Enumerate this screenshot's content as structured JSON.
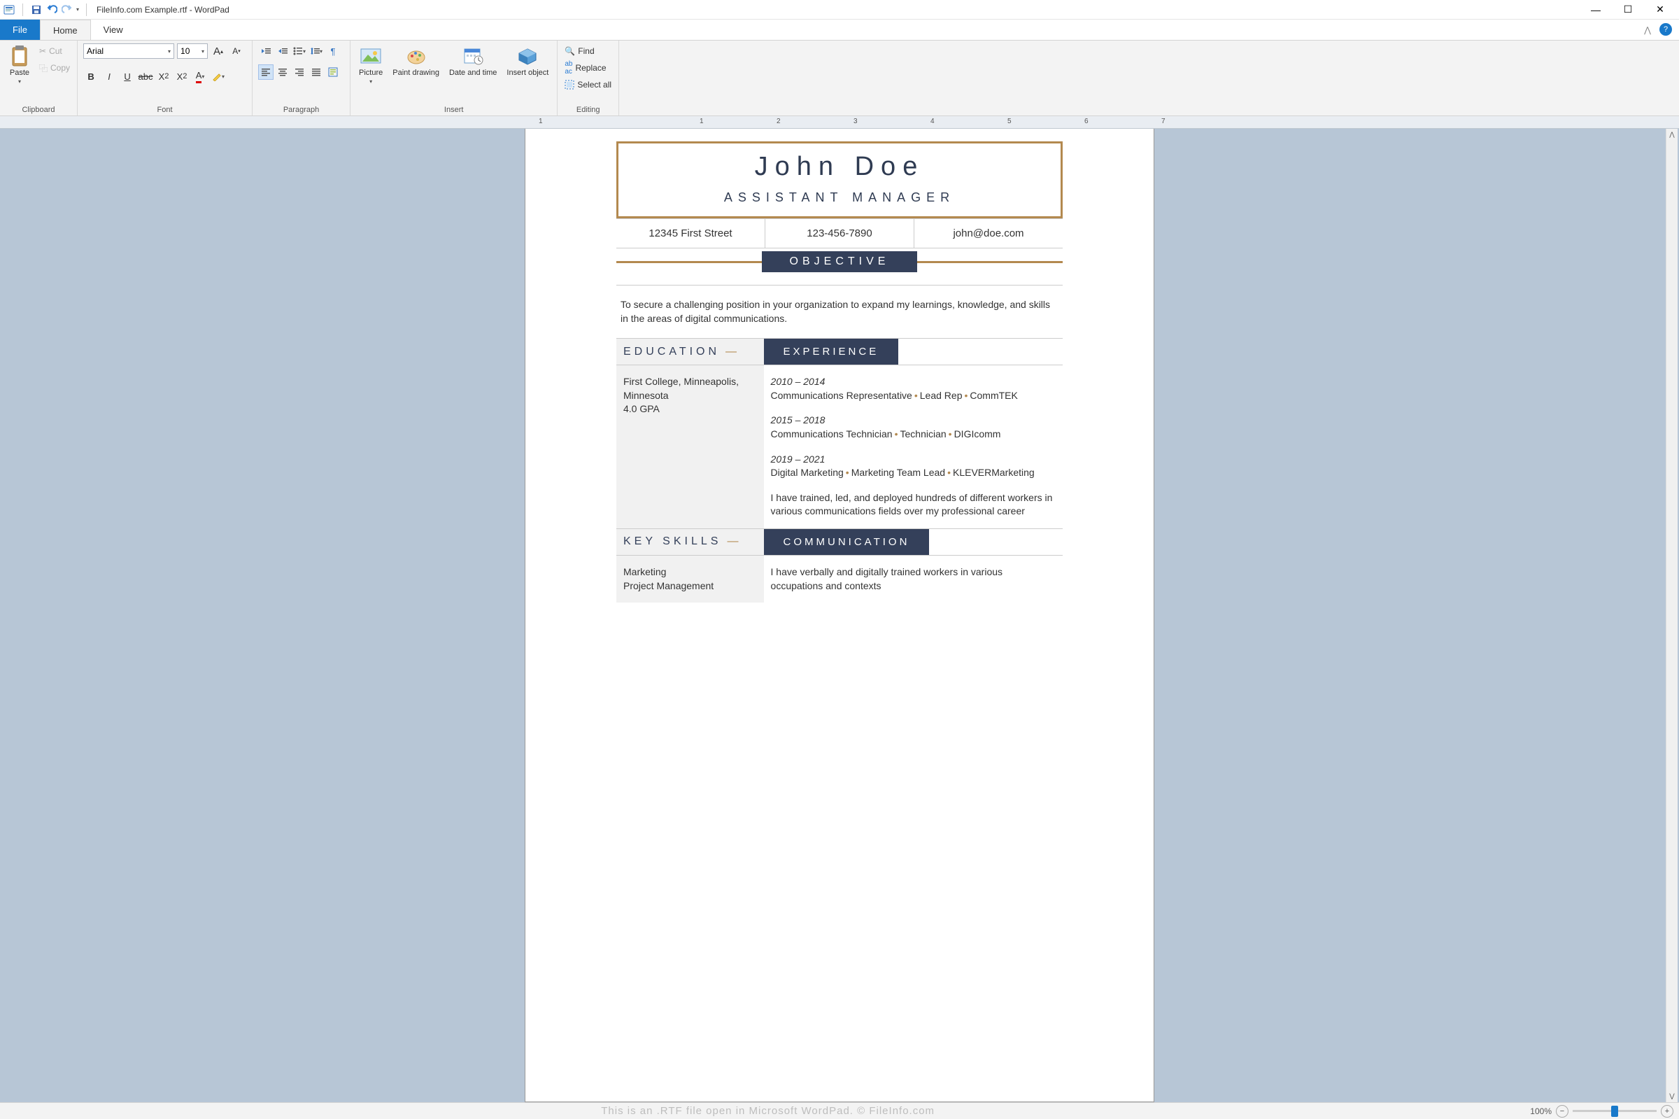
{
  "window": {
    "title": "FileInfo.com Example.rtf - WordPad"
  },
  "tabs": {
    "file": "File",
    "home": "Home",
    "view": "View"
  },
  "ribbon": {
    "clipboard": {
      "label": "Clipboard",
      "paste": "Paste",
      "cut": "Cut",
      "copy": "Copy"
    },
    "font": {
      "label": "Font",
      "family": "Arial",
      "size": "10"
    },
    "paragraph": {
      "label": "Paragraph"
    },
    "insert": {
      "label": "Insert",
      "picture": "Picture",
      "paint": "Paint drawing",
      "datetime": "Date and time",
      "object": "Insert object"
    },
    "editing": {
      "label": "Editing",
      "find": "Find",
      "replace": "Replace",
      "select_all": "Select all"
    }
  },
  "ruler": {
    "nums": [
      "1",
      "1",
      "2",
      "3",
      "4",
      "5",
      "6",
      "7"
    ]
  },
  "doc": {
    "name": "John Doe",
    "role": "ASSISTANT MANAGER",
    "contact": {
      "address": "12345 First Street",
      "phone": "123-456-7890",
      "email": "john@doe.com"
    },
    "objective_label": "OBJECTIVE",
    "objective_text": "To secure a challenging position in your organization to expand my learnings, knowledge, and skills in the areas of digital communications.",
    "education_label": "EDUCATION",
    "experience_label": "EXPERIENCE",
    "education": {
      "school": "First College, Minneapolis, Minnesota",
      "gpa": "4.0 GPA"
    },
    "jobs": [
      {
        "dates": "2010 – 2014",
        "title": "Communications Representative",
        "role": "Lead Rep",
        "company": "CommTEK"
      },
      {
        "dates": "2015 – 2018",
        "title": "Communications Technician",
        "role": "Technician",
        "company": "DIGIcomm"
      },
      {
        "dates": "2019 – 2021",
        "title": "Digital Marketing",
        "role": "Marketing Team Lead",
        "company": "KLEVERMarketing"
      }
    ],
    "experience_summary": "I have trained, led, and deployed hundreds of different workers in various communications fields over my professional career",
    "keyskills_label": "KEY SKILLS",
    "communication_label": "COMMUNICATION",
    "skills": [
      "Marketing",
      "Project Management"
    ],
    "communication_text": "I have verbally and digitally trained workers in various occupations and contexts"
  },
  "status": {
    "watermark": "This is an .RTF file open in Microsoft WordPad. © FileInfo.com",
    "zoom": "100%"
  }
}
